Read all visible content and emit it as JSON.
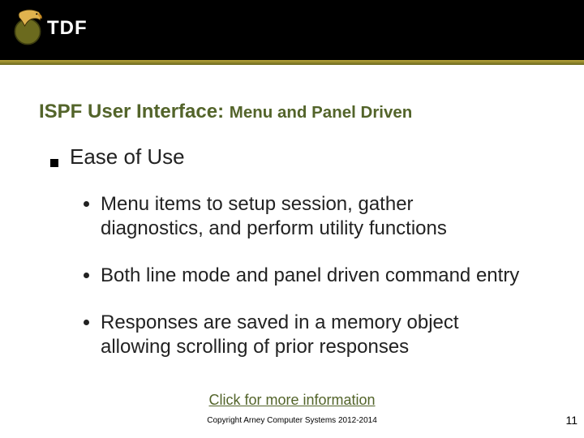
{
  "header": {
    "logo_text": "TDF",
    "logo_sub": ""
  },
  "title": {
    "main": "ISPF User Interface:",
    "sub": "Menu and Panel Driven"
  },
  "section_heading": "Ease of Use",
  "bullets": [
    "Menu items to setup session, gather diagnostics, and perform utility functions",
    "Both line mode and panel driven command entry",
    "Responses are saved in a memory object allowing scrolling of prior responses"
  ],
  "more_info_link": "Click for more information",
  "copyright": "Copyright Arney Computer Systems 2012-2014",
  "page_number": "11"
}
